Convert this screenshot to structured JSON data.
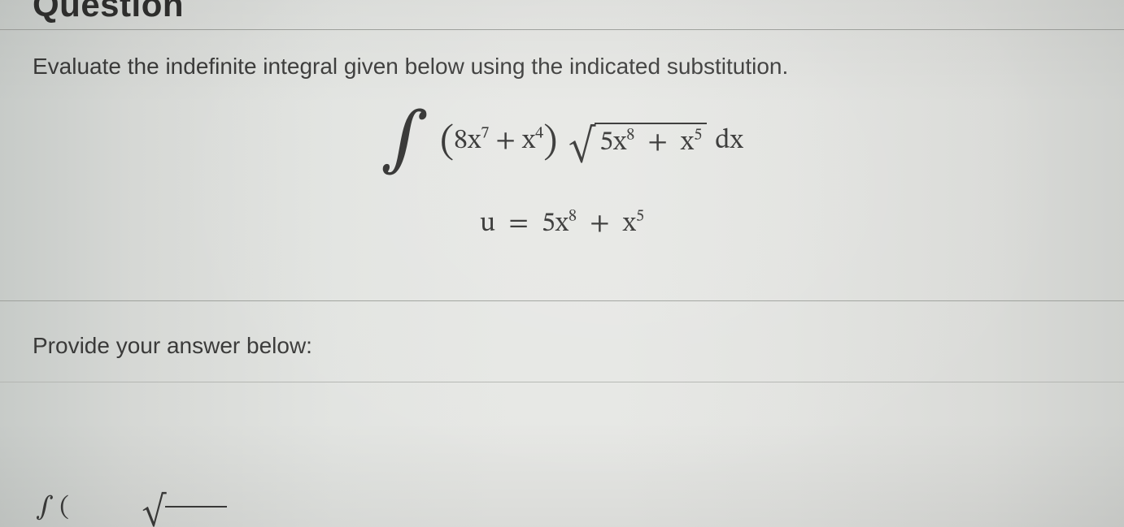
{
  "heading": "Question",
  "prompt": "Evaluate the indefinite integral given below using the indicated substitution.",
  "integral": {
    "term1_coef": "8x",
    "term1_exp": "7",
    "term2_coef": "x",
    "term2_exp": "4",
    "rad_a_coef": "5x",
    "rad_a_exp": "8",
    "rad_b_coef": "x",
    "rad_b_exp": "5",
    "dx": "dx"
  },
  "substitution": {
    "lhs": "u",
    "eq": "=",
    "a_coef": "5x",
    "a_exp": "8",
    "b_coef": "x",
    "b_exp": "5"
  },
  "answer_label": "Provide your answer below:",
  "footer": {
    "fprime": "∫ ("
  }
}
